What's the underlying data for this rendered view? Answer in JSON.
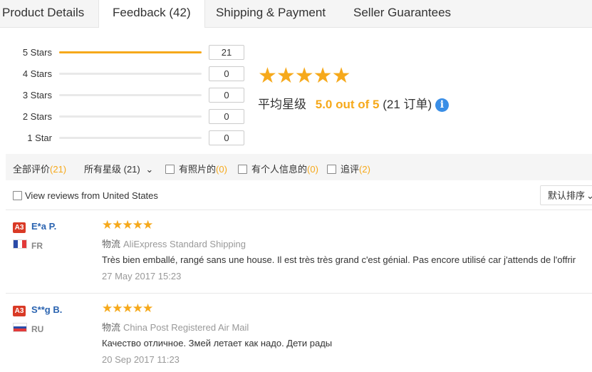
{
  "tabs": [
    {
      "label": "Product Details"
    },
    {
      "label": "Feedback (42)"
    },
    {
      "label": "Shipping & Payment"
    },
    {
      "label": "Seller Guarantees"
    }
  ],
  "rating_histogram": [
    {
      "label": "5 Stars",
      "count": "21",
      "fill_fraction": 1.0
    },
    {
      "label": "4 Stars",
      "count": "0",
      "fill_fraction": 0
    },
    {
      "label": "3 Stars",
      "count": "0",
      "fill_fraction": 0
    },
    {
      "label": "2 Stars",
      "count": "0",
      "fill_fraction": 0
    },
    {
      "label": "1 Star",
      "count": "0",
      "fill_fraction": 0
    }
  ],
  "summary": {
    "stars": "★★★★★",
    "avg_label": "平均星级",
    "score": "5.0 out of 5",
    "count_text": "(21 订单)",
    "info_glyph": "i"
  },
  "filters": {
    "all_label": "全部评价",
    "all_count": "(21)",
    "stars_label": "所有星级 (21)",
    "stars_chevron": "⌄",
    "photo_label": "有照片的",
    "photo_count": "(0)",
    "personal_label": "有个人信息的",
    "personal_count": "(0)",
    "followup_label": "追评",
    "followup_count": "(2)"
  },
  "view_reviews": "View reviews from United States",
  "sort": {
    "label": "默认排序",
    "chevron": "⌄"
  },
  "reviews": [
    {
      "badge": "A3",
      "name": "E*a P.",
      "country": "FR",
      "stars": "★★★★★",
      "logistics_label": "物流",
      "logistics": "AliExpress Standard Shipping",
      "text": "Très bien emballé, rangé sans une house. Il est très très grand c'est génial. Pas encore utilisé car j'attends de l'offrir",
      "date": "27 May 2017 15:23"
    },
    {
      "badge": "A3",
      "name": "S**g B.",
      "country": "RU",
      "stars": "★★★★★",
      "logistics_label": "物流",
      "logistics": "China Post Registered Air Mail",
      "text": "Качество отличное. Змей летает как надо. Дети рады",
      "date": "20 Sep 2017 11:23"
    }
  ],
  "colors": {
    "accent": "#f6a91b",
    "link": "#2a63b0",
    "badge": "#d93a26",
    "info": "#3a8ee6"
  },
  "icons": [
    "star-icon",
    "info-icon",
    "chevron-down-icon",
    "checkbox-icon",
    "flag-fr-icon",
    "flag-ru-icon"
  ]
}
